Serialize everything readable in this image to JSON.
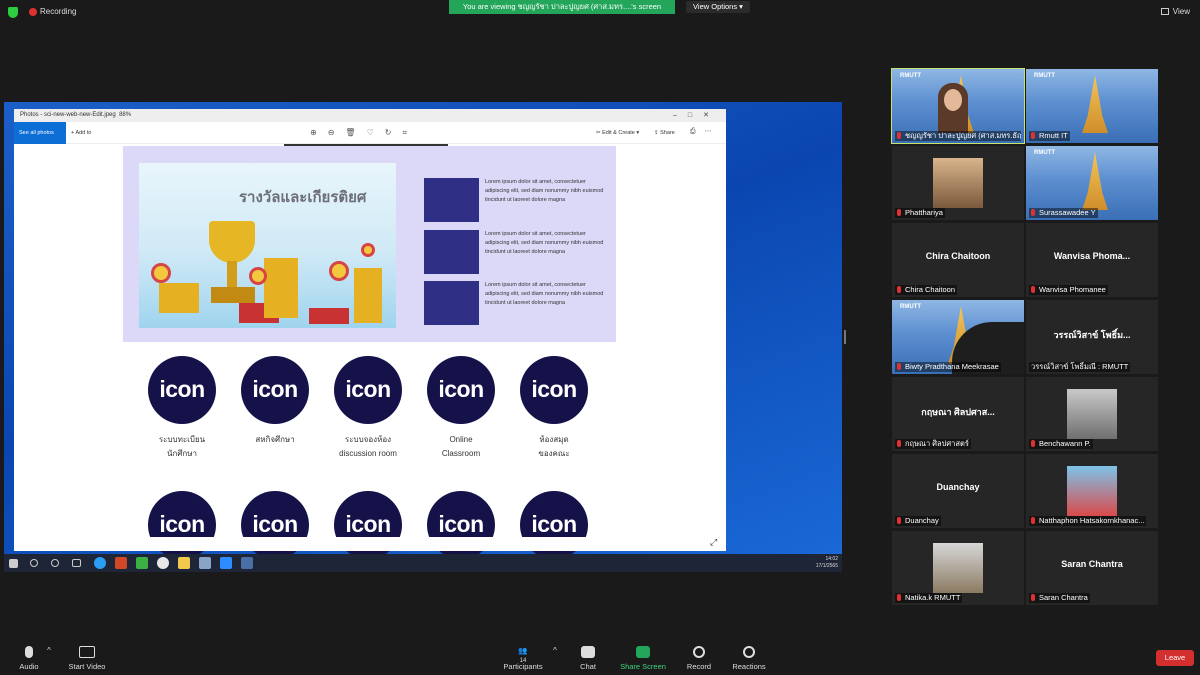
{
  "topbar": {
    "recording_label": "Recording",
    "viewing_banner": "You are viewing ชญญรัชา ปาละปูญยศ (ศาส.มทร....'s screen",
    "view_options_label": "View Options",
    "view_label": "View"
  },
  "photos_app": {
    "title": "Photos - sci-new-web-new-Edit.jpeg",
    "zoom": "88%",
    "see_all": "See all photos",
    "add_to": "Add to",
    "edit_create": "Edit & Create",
    "share": "Share"
  },
  "slide": {
    "banner_title": "รางวัลและเกียรติยศ",
    "lorem_1": "Lorem ipsum dolor sit amet, consectetuer adipiscing elit, sed diam nonummy nibh euismod tincidunt ut laoreet dolore magna",
    "lorem_2": "Lorem ipsum dolor sit amet, consectetuer adipiscing elit, sed diam nonummy nibh euismod tincidunt ut laoreet dolore magna",
    "lorem_3": "Lorem ipsum dolor sit amet, consectetuer adipiscing elit, sed diam nonummy nibh euismod tincidunt ut laoreet dolore magna",
    "icon_text": "icon",
    "labels": [
      {
        "line1": "ระบบทะเบียน",
        "line2": "นักศึกษา"
      },
      {
        "line1": "สหกิจศึกษา",
        "line2": ""
      },
      {
        "line1": "ระบบจองห้อง",
        "line2": "discussion room"
      },
      {
        "line1": "Online",
        "line2": "Classroom"
      },
      {
        "line1": "ห้องสมุด",
        "line2": "ของคณะ"
      }
    ]
  },
  "taskbar": {
    "time": "14:02",
    "date": "17/1/2565"
  },
  "participants": [
    {
      "name": "ชญญรัชา ปาละปูญยศ (ศาส.มทร.ธัญ...",
      "logo": "RMUTT"
    },
    {
      "name": "Rmutt IT",
      "logo": "RMUTT"
    },
    {
      "name": "Phatthariya"
    },
    {
      "name": "Surassawadee Y",
      "logo": "RMUTT"
    },
    {
      "name": "Chira Chaitoon",
      "big": "Chira Chaitoon"
    },
    {
      "name": "Wanvisa Phomanee",
      "big": "Wanvisa  Phoma..."
    },
    {
      "name": "Biwty Pradthana Meekrasae",
      "logo": "RMUTT"
    },
    {
      "name": "วรรณ์วิสาข์ โพธิ์มณี : RMUTT",
      "big": "วรรณ์วิสาข์ โพธิ์ม..."
    },
    {
      "name": "กฤษณา  ศิลปศาสตร์",
      "big": "กฤษณา  ศิลปศาส..."
    },
    {
      "name": "Benchawann P."
    },
    {
      "name": "Duanchay",
      "big": "Duanchay"
    },
    {
      "name": "Natthaphon Hatsakornkhanac..."
    },
    {
      "name": "Natika.k RMUTT"
    },
    {
      "name": "Saran Chantra",
      "big": "Saran Chantra"
    }
  ],
  "bottombar": {
    "audio": "Audio",
    "start_video": "Start Video",
    "participants": "Participants",
    "participants_count": "14",
    "chat": "Chat",
    "share_screen": "Share Screen",
    "record": "Record",
    "reactions": "Reactions",
    "leave": "Leave"
  }
}
